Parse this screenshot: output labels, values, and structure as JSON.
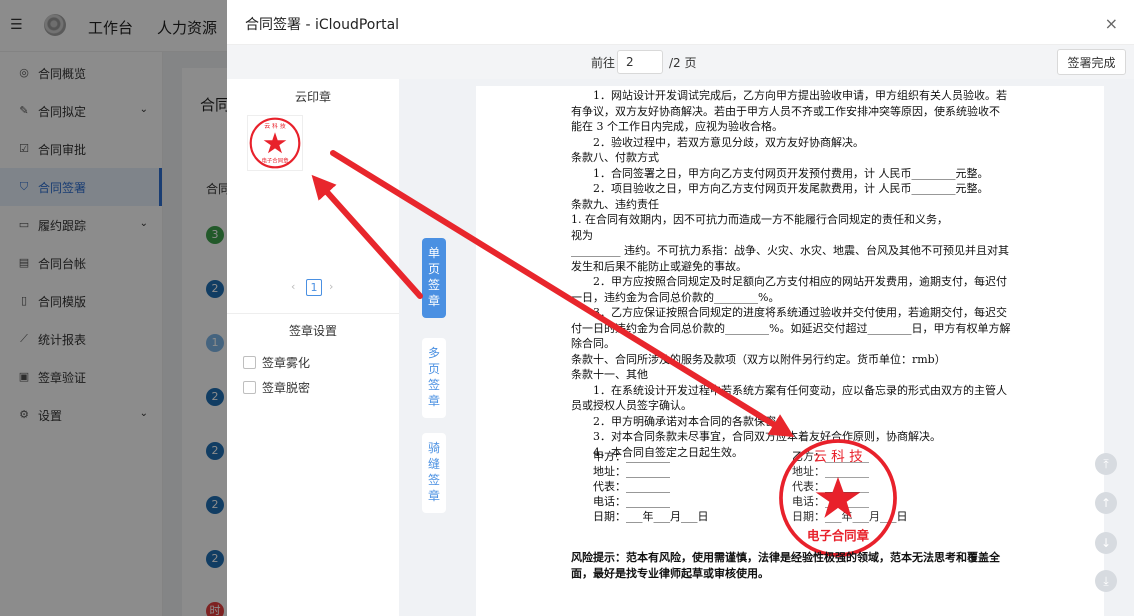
{
  "app": {
    "nav": [
      "工作台",
      "人力资源"
    ],
    "sidebar": [
      {
        "label": "合同概览",
        "icon": "globe-icon",
        "chevron": false
      },
      {
        "label": "合同拟定",
        "icon": "edit-icon",
        "chevron": true
      },
      {
        "label": "合同审批",
        "icon": "check-square-icon",
        "chevron": false
      },
      {
        "label": "合同签署",
        "icon": "shield-check-icon",
        "chevron": false,
        "active": true
      },
      {
        "label": "履约跟踪",
        "icon": "card-icon",
        "chevron": true
      },
      {
        "label": "合同台帐",
        "icon": "ledger-icon",
        "chevron": false
      },
      {
        "label": "合同模版",
        "icon": "document-icon",
        "chevron": false
      },
      {
        "label": "统计报表",
        "icon": "line-chart-icon",
        "chevron": false
      },
      {
        "label": "签章验证",
        "icon": "stamp-check-icon",
        "chevron": false
      },
      {
        "label": "设置",
        "icon": "gear-icon",
        "chevron": true
      }
    ],
    "content_title": "合同",
    "content_col": "合同",
    "badges": [
      "3",
      "2",
      "2",
      "1",
      "2",
      "2",
      "2",
      "2",
      "时"
    ]
  },
  "modal": {
    "title": "合同签署 - iCloudPortal",
    "close": "×",
    "goto_label": "前往",
    "page_value": "2",
    "pages_total": "/2 页",
    "done_button": "签署完成",
    "seal_panel_title": "云印章",
    "seal_pager": {
      "current": "1",
      "prev": "‹",
      "next": "›"
    },
    "settings_title": "签章设置",
    "options": [
      "签章雾化",
      "签章脱密"
    ],
    "tabs": [
      "单页签章",
      "多页签章",
      "骑缝签章"
    ],
    "seal_text": {
      "top": "云 科 技",
      "bottom": "电子合同章"
    },
    "side_buttons": [
      "top-icon",
      "up-icon",
      "down-icon",
      "bottom-icon"
    ]
  },
  "document": {
    "lines": [
      {
        "t": "1．网站设计开发调试完成后，乙方向甲方提出验收申请，甲方组织有关人员验收。若",
        "indent": true
      },
      {
        "t": "有争议，双方友好协商解决。若由于甲方人员不齐或工作安排冲突等原因，使系统验收不",
        "indent": false
      },
      {
        "t": "能在 3 个工作日内完成，应视为验收合格。",
        "indent": false
      },
      {
        "t": "2．验收过程中，若双方意见分歧，双方友好协商解决。",
        "indent": true
      },
      {
        "t": "条款八、付款方式",
        "indent": false
      },
      {
        "t": "1．合同签署之日，甲方向乙方支付网页开发预付费用，计 人民币________元整。",
        "indent": true
      },
      {
        "t": "2．项目验收之日，甲方向乙方支付网页开发尾款费用，计 人民币________元整。",
        "indent": true
      },
      {
        "t": "条款九、违约责任",
        "indent": false
      },
      {
        "t": "1. 在合同有效期内，因不可抗力而造成一方不能履行合同规定的责任和义务，",
        "indent": false
      },
      {
        "t": "视为",
        "indent": false
      },
      {
        "t": "_________ 违约。不可抗力系指：战争、火灾、水灾、地震、台风及其他不可预见并且对其",
        "indent": false
      },
      {
        "t": "发生和后果不能防止或避免的事故。",
        "indent": false
      },
      {
        "t": "2．甲方应按照合同规定及时足额向乙方支付相应的网站开发费用，逾期支付，每迟付",
        "indent": true
      },
      {
        "t": "一日，违约金为合同总价款的________%。",
        "indent": false
      },
      {
        "t": "3．乙方应保证按照合同规定的进度将系统通过验收并交付使用，若逾期交付，每迟交",
        "indent": true
      },
      {
        "t": "付一日的违约金为合同总价款的________%。如延迟交付超过________日，甲方有权单方解",
        "indent": false
      },
      {
        "t": "除合同。",
        "indent": false
      },
      {
        "t": "条款十、合同所涉及的服务及款项（双方以附件另行约定。货币单位：rmb）",
        "indent": false
      },
      {
        "t": "条款十一、其他",
        "indent": false
      },
      {
        "t": "1．在系统设计开发过程中若系统方案有任何变动，应以备忘录的形式由双方的主管人",
        "indent": true
      },
      {
        "t": "员或授权人员签字确认。",
        "indent": false
      },
      {
        "t": "2．甲方明确承诺对本合同的各款保密。",
        "indent": true
      },
      {
        "t": "3．对本合同条款未尽事宜，合同双方应本着友好合作原则，协商解决。",
        "indent": true
      },
      {
        "t": "4．本合同自签定之日起生效。",
        "indent": true
      }
    ],
    "party_a": [
      "甲方：________",
      "地址：________",
      "代表：________",
      "电话：________",
      "日期：___年___月___日"
    ],
    "party_b": [
      "乙方：________",
      "地址：________",
      "代表：________",
      "电话：________",
      "日期：___年___月___日"
    ],
    "risk": "风险提示：范本有风险，使用需谨慎，法律是经验性极强的领域，范本无法思考和覆盖全面，最好是找专业律师起草或审核使用。"
  },
  "colors": {
    "accent": "#4a90e2",
    "seal": "#e8212b",
    "annotation_arrow": "#e8262c"
  }
}
